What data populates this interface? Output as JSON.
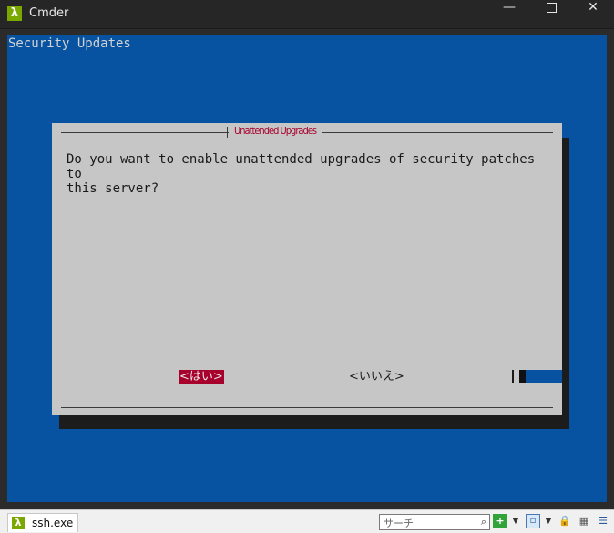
{
  "window": {
    "title": "Cmder",
    "app_icon": "λ",
    "minimize_glyph": "—",
    "close_glyph": "✕"
  },
  "terminal": {
    "header": "Security Updates",
    "dialog": {
      "title": "Unattended Upgrades",
      "message": "Do you want to enable unattended upgrades of security patches to\nthis server?",
      "yes_button": "<はい>",
      "no_button": "<いいえ>"
    }
  },
  "statusbar": {
    "tab_icon": "λ",
    "tab_label": "ssh.exe",
    "search_placeholder": "サーチ",
    "search_icon": "⌕",
    "icons": {
      "new_console": "+",
      "dropdown": "▼",
      "panel": "▫",
      "lock": "🔒",
      "grid": "▦",
      "menu": "☰"
    }
  }
}
